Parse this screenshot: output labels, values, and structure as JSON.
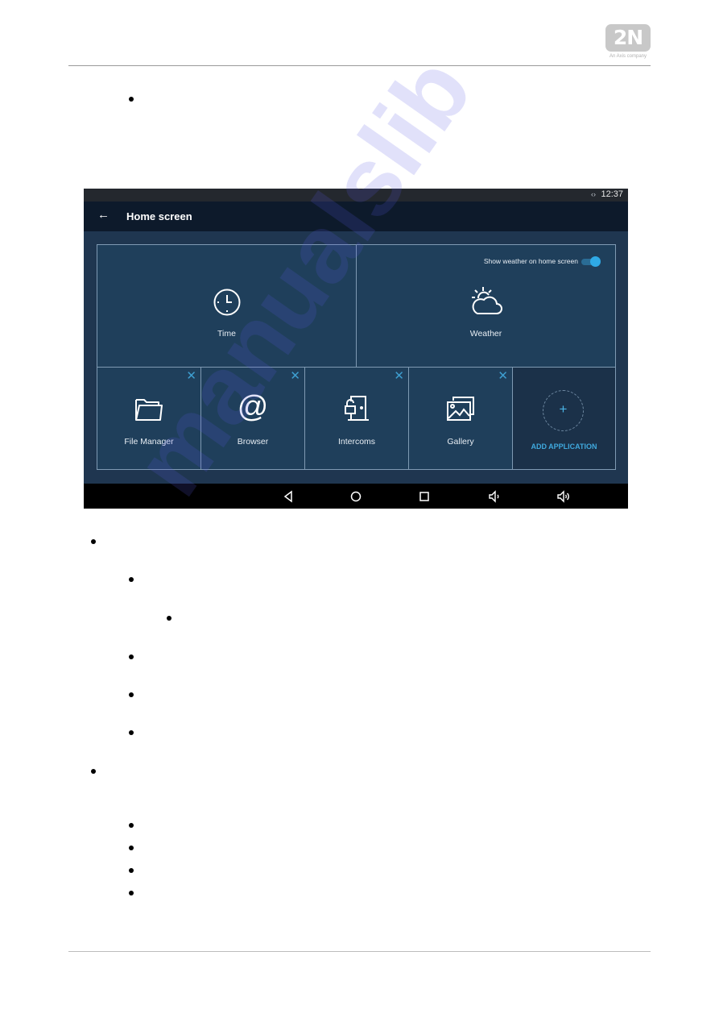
{
  "document": {
    "logo_text": "2N",
    "logo_tagline": "An Axis company",
    "watermark": "manualslib"
  },
  "device_screen": {
    "status_bar": {
      "time": "12:37",
      "signal_icon": "code-arrows-icon"
    },
    "app_bar": {
      "back_icon": "arrow-left-icon",
      "title": "Home screen"
    },
    "widgets": [
      {
        "label": "Time",
        "icon": "clock-icon"
      },
      {
        "label": "Weather",
        "icon": "weather-icon"
      }
    ],
    "weather_toggle": {
      "label": "Show weather on home screen",
      "enabled": true
    },
    "apps": [
      {
        "label": "File Manager",
        "icon": "folder-icon",
        "removable": true
      },
      {
        "label": "Browser",
        "icon": "at-sign-icon",
        "removable": true
      },
      {
        "label": "Intercoms",
        "icon": "door-lock-icon",
        "removable": true
      },
      {
        "label": "Gallery",
        "icon": "gallery-icon",
        "removable": true
      }
    ],
    "add_application": {
      "label": "ADD APPLICATION",
      "plus": "+"
    },
    "close_glyph": "✕",
    "nav_bar": [
      "back",
      "home",
      "recents",
      "volume-down",
      "volume-up"
    ],
    "colors": {
      "accent": "#2fa9e5",
      "tile": "#1f3f5b",
      "appbar": "#0d1a2b",
      "navbar": "#000000"
    }
  }
}
